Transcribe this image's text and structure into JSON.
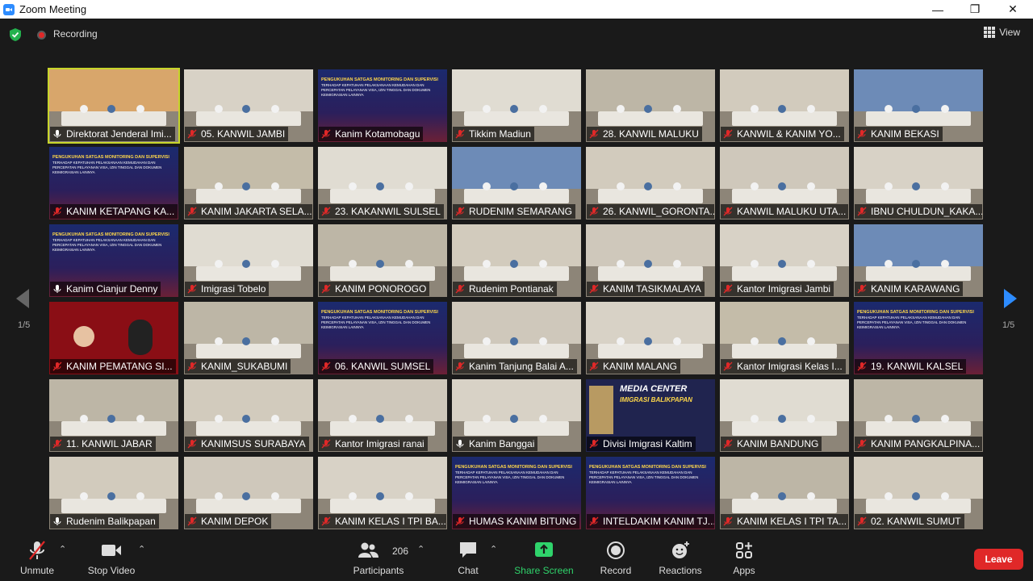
{
  "window": {
    "title": "Zoom Meeting"
  },
  "topbar": {
    "recording_label": "Recording",
    "view_label": "View"
  },
  "gallery": {
    "page_indicator_left": "1/5",
    "page_indicator_right": "1/5",
    "tiles": [
      {
        "name": "Direktorat Jenderal Imi...",
        "scene": "room-wide",
        "muted": false,
        "active": true
      },
      {
        "name": "05. KANWIL JAMBI",
        "scene": "room",
        "muted": true
      },
      {
        "name": "Kanim Kotamobagu",
        "scene": "slide",
        "muted": true
      },
      {
        "name": "Tikkim Madiun",
        "scene": "room",
        "muted": true
      },
      {
        "name": "28. KANWIL MALUKU",
        "scene": "room",
        "muted": true
      },
      {
        "name": "KANWIL & KANIM  YO...",
        "scene": "room",
        "muted": true
      },
      {
        "name": "KANIM BEKASI",
        "scene": "room-blue",
        "muted": true
      },
      {
        "name": "KANIM KETAPANG KA...",
        "scene": "slide",
        "muted": true
      },
      {
        "name": "KANIM JAKARTA SELA...",
        "scene": "room",
        "muted": true
      },
      {
        "name": "23. KAKANWIL SULSEL",
        "scene": "room",
        "muted": true
      },
      {
        "name": "RUDENIM SEMARANG",
        "scene": "room-blue",
        "muted": true
      },
      {
        "name": "26. KANWIL_GORONTA...",
        "scene": "room",
        "muted": true
      },
      {
        "name": "KANWIL MALUKU UTA...",
        "scene": "room",
        "muted": true
      },
      {
        "name": "IBNU CHULDUN_KAKA...",
        "scene": "room",
        "muted": true
      },
      {
        "name": "Kanim Cianjur Denny",
        "scene": "slide",
        "muted": false
      },
      {
        "name": "Imigrasi Tobelo",
        "scene": "room",
        "muted": true
      },
      {
        "name": "KANIM PONOROGO",
        "scene": "room",
        "muted": true
      },
      {
        "name": "Rudenim Pontianak",
        "scene": "room",
        "muted": true
      },
      {
        "name": "KANIM TASIKMALAYA",
        "scene": "room",
        "muted": true
      },
      {
        "name": "Kantor Imigrasi Jambi",
        "scene": "room",
        "muted": true
      },
      {
        "name": "KANIM KARAWANG",
        "scene": "room-blue",
        "muted": true
      },
      {
        "name": "KANIM PEMATANG SI...",
        "scene": "red",
        "muted": true
      },
      {
        "name": "KANIM_SUKABUMI",
        "scene": "room",
        "muted": true
      },
      {
        "name": "06. KANWIL SUMSEL",
        "scene": "slide",
        "muted": true
      },
      {
        "name": "Kanim Tanjung Balai A...",
        "scene": "room",
        "muted": true
      },
      {
        "name": "KANIM MALANG",
        "scene": "room",
        "muted": true
      },
      {
        "name": "Kantor Imigrasi Kelas I...",
        "scene": "room",
        "muted": true
      },
      {
        "name": "19. KANWIL KALSEL",
        "scene": "slide",
        "muted": true
      },
      {
        "name": "11. KANWIL JABAR",
        "scene": "room",
        "muted": true
      },
      {
        "name": "KANIMSUS SURABAYA",
        "scene": "room",
        "muted": true
      },
      {
        "name": "Kantor Imigrasi ranai",
        "scene": "room",
        "muted": true
      },
      {
        "name": "Kanim Banggai",
        "scene": "room",
        "muted": false
      },
      {
        "name": "Divisi Imigrasi Kaltim",
        "scene": "media",
        "muted": true,
        "media_line1": "MEDIA CENTER",
        "media_line2": "IMIGRASI BALIKPAPAN"
      },
      {
        "name": "KANIM BANDUNG",
        "scene": "room",
        "muted": true
      },
      {
        "name": "KANIM PANGKALPINA...",
        "scene": "room",
        "muted": true
      },
      {
        "name": "Rudenim Balikpapan",
        "scene": "room",
        "muted": false
      },
      {
        "name": "KANIM DEPOK",
        "scene": "room",
        "muted": true
      },
      {
        "name": "KANIM KELAS I TPI BA...",
        "scene": "room",
        "muted": true
      },
      {
        "name": "HUMAS KANIM BITUNG",
        "scene": "slide",
        "muted": true
      },
      {
        "name": "INTELDAKIM KANIM TJ...",
        "scene": "slide",
        "muted": true
      },
      {
        "name": "KANIM KELAS I TPI TA...",
        "scene": "room",
        "muted": true
      },
      {
        "name": "02. KANWIL SUMUT",
        "scene": "room",
        "muted": true
      }
    ],
    "slide_line1": "PENGUKUHAN SATGAS MONITORING DAN SUPERVISI",
    "slide_line2": "TERHADAP KEPATUHAN PELAKSANAAN KEMUDAHAN DAN PERCEPATAN PELAYANAN VISA, IZIN TINGGAL DAN DOKUMEN KEIMIGRASIAN LAINNYA"
  },
  "toolbar": {
    "unmute": "Unmute",
    "stop_video": "Stop Video",
    "participants": "Participants",
    "participant_count": "206",
    "chat": "Chat",
    "share_screen": "Share Screen",
    "record": "Record",
    "reactions": "Reactions",
    "apps": "Apps",
    "leave": "Leave"
  },
  "colors": {
    "accent_green": "#2fd36b",
    "leave_red": "#e02828",
    "active_speaker": "#c7d52a"
  }
}
